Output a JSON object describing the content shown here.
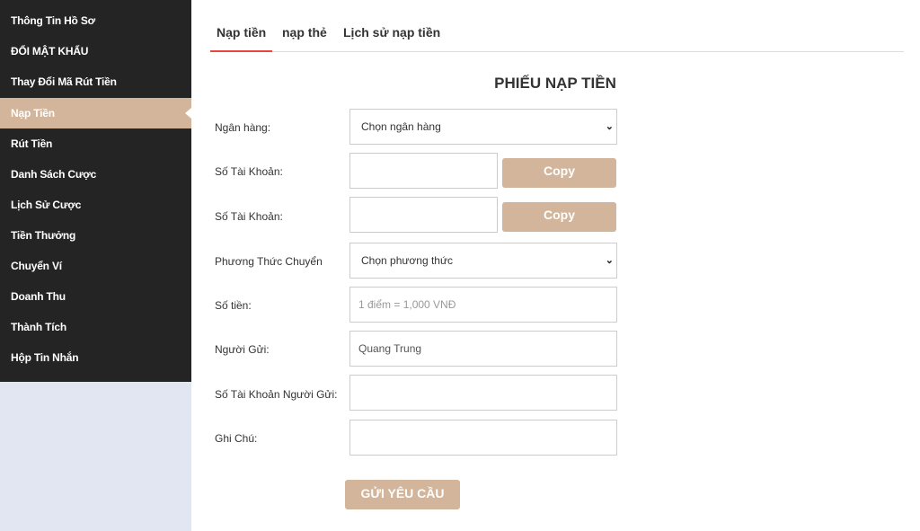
{
  "sidebar": {
    "items": [
      {
        "label": "Thông Tin Hồ Sơ"
      },
      {
        "label": "ĐỔI MẬT KHẨU"
      },
      {
        "label": "Thay Đổi Mã Rút Tiền"
      },
      {
        "label": "Nạp Tiền",
        "active": true
      },
      {
        "label": "Rút Tiền"
      },
      {
        "label": "Danh Sách Cược"
      },
      {
        "label": "Lịch Sử Cược"
      },
      {
        "label": "Tiền Thưởng"
      },
      {
        "label": "Chuyển Ví"
      },
      {
        "label": "Doanh Thu"
      },
      {
        "label": "Thành Tích"
      },
      {
        "label": "Hộp Tin Nhắn"
      }
    ]
  },
  "tabs": [
    {
      "label": "Nạp tiền",
      "active": true
    },
    {
      "label": "nạp thẻ"
    },
    {
      "label": "Lịch sử nạp tiền"
    }
  ],
  "form": {
    "title": "PHIẾU NẠP TIỀN",
    "bank_label": "Ngân hàng:",
    "bank_value": "Chọn ngân hàng",
    "account1_label": "Số Tài Khoản:",
    "account2_label": "Số Tài Khoản:",
    "copy_label": "Copy",
    "method_label": "Phương Thức Chuyển",
    "method_value": "Chọn phương thức",
    "amount_label": "Số tiền:",
    "amount_placeholder": "1 điểm = 1,000 VNĐ",
    "sender_label": "Người Gửi:",
    "sender_value": "Quang Trung",
    "sender_account_label": "Số Tài Khoản Người Gửi:",
    "note_label": "Ghi Chú:",
    "submit_label": "GỬI YÊU CẦU"
  },
  "colors": {
    "sidebar_bg": "#242424",
    "accent": "#d2b59a",
    "tab_underline": "#e8453c"
  }
}
